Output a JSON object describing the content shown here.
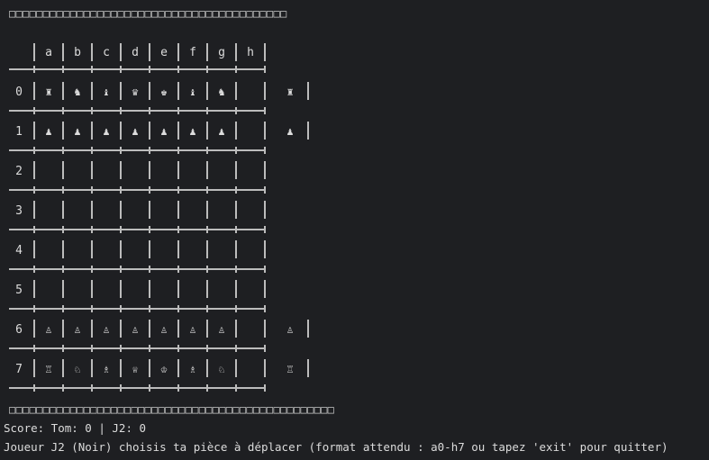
{
  "terminal": {
    "top_boxes": "□□□□□□□□□□□□□□□□□□□□□□□□□□□□□□□□□□□□□□□□□",
    "bottom_boxes": "□□□□□□□□□□□□□□□□□□□□□□□□□□□□□□□□□□□□□□□□□□□□□□□□",
    "score_line": "Score: Tom: 0 | J2: 0",
    "prompt_line": "Joueur J2 (Noir) choisis ta pièce à déplacer (format attendu : a0-h7 ou tapez 'exit' pour quitter)"
  },
  "board": {
    "columns": [
      "a",
      "b",
      "c",
      "d",
      "e",
      "f",
      "g",
      "h"
    ],
    "rows": [
      {
        "label": "0",
        "cells": [
          "♜",
          "♞",
          "♝",
          "♛",
          "♚",
          "♝",
          "♞",
          "♜"
        ],
        "overflow": true
      },
      {
        "label": "1",
        "cells": [
          "♟",
          "♟",
          "♟",
          "♟",
          "♟",
          "♟",
          "♟",
          "♟"
        ],
        "overflow": true
      },
      {
        "label": "2",
        "cells": [
          "",
          "",
          "",
          "",
          "",
          "",
          "",
          ""
        ],
        "overflow": false
      },
      {
        "label": "3",
        "cells": [
          "",
          "",
          "",
          "",
          "",
          "",
          "",
          ""
        ],
        "overflow": false
      },
      {
        "label": "4",
        "cells": [
          "",
          "",
          "",
          "",
          "",
          "",
          "",
          ""
        ],
        "overflow": false
      },
      {
        "label": "5",
        "cells": [
          "",
          "",
          "",
          "",
          "",
          "",
          "",
          ""
        ],
        "overflow": false
      },
      {
        "label": "6",
        "cells": [
          "♙",
          "♙",
          "♙",
          "♙",
          "♙",
          "♙",
          "♙",
          "♙"
        ],
        "overflow": true
      },
      {
        "label": "7",
        "cells": [
          "♖",
          "♘",
          "♗",
          "♕",
          "♔",
          "♗",
          "♘",
          "♖"
        ],
        "overflow": true
      }
    ]
  },
  "colors": {
    "background": "#1e1f22",
    "text": "#dcdcdc",
    "grid": "#bcbcbc"
  }
}
